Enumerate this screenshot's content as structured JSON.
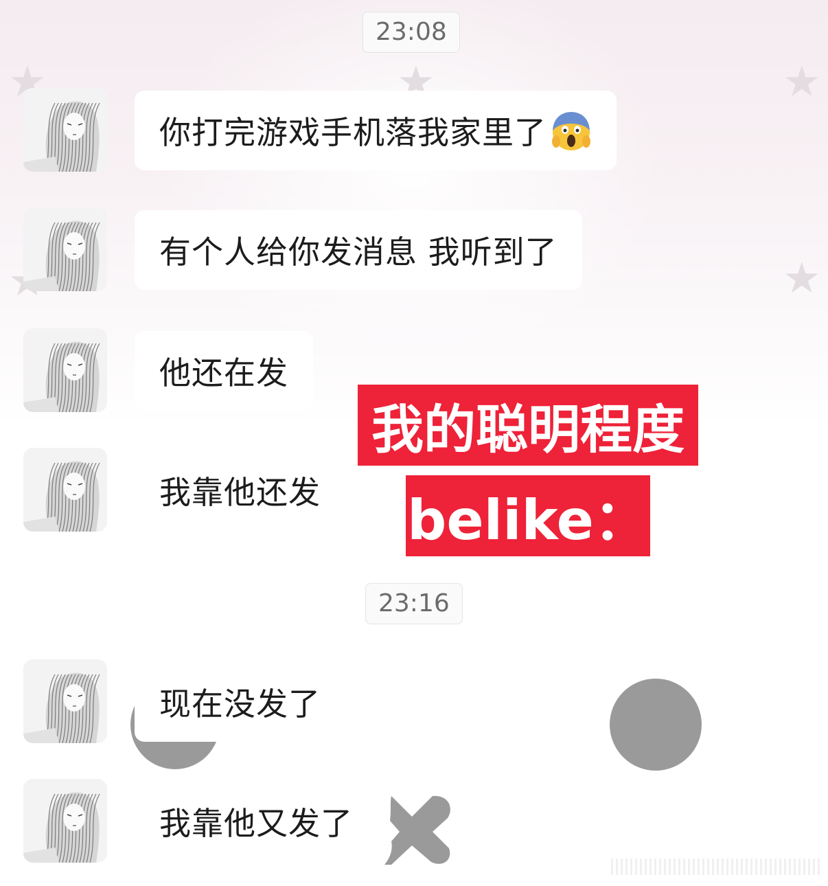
{
  "timestamps": [
    "23:08",
    "23:16"
  ],
  "messages": [
    {
      "text": "你打完游戏手机落我家里了",
      "emoji": "screaming-face-emoji"
    },
    {
      "text": "有个人给你发消息 我听到了"
    },
    {
      "text": "他还在发"
    },
    {
      "text": "我靠他还发"
    },
    {
      "text": "现在没发了"
    },
    {
      "text": "我靠他又发了"
    }
  ],
  "overlay": {
    "line1": "我的聪明程度",
    "line2": "belike：",
    "color": "#ee2238"
  },
  "colors": {
    "bubble": "#ffffff",
    "text": "#1c1c1c",
    "timestamp_text": "#6b6b6b",
    "gray_shape": "#9a9a9a"
  }
}
